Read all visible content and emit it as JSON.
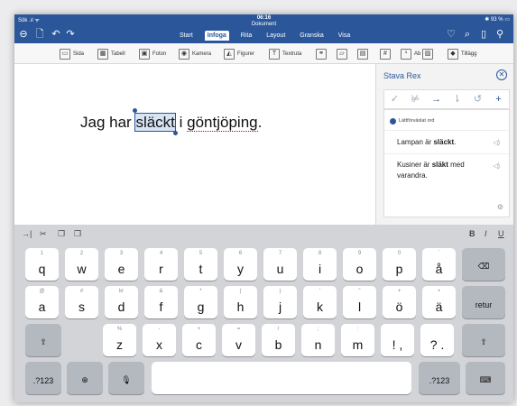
{
  "status": {
    "left": "Sök  .ıl ᯤ",
    "time": "06:16",
    "document": "Dokument",
    "battery": "93 %"
  },
  "ribbon_tabs": [
    "Start",
    "Infoga",
    "Rita",
    "Layout",
    "Granska",
    "Visa"
  ],
  "active_tab": "Infoga",
  "ribbon_items": [
    {
      "label": "Sida",
      "icon": "page-icon"
    },
    {
      "label": "Tabell",
      "icon": "table-icon"
    },
    {
      "label": "Foton",
      "icon": "photo-icon"
    },
    {
      "label": "Kamera",
      "icon": "camera-icon"
    },
    {
      "label": "Figurer",
      "icon": "shapes-icon"
    },
    {
      "label": "Textruta",
      "icon": "textbox-icon"
    },
    {
      "label": "",
      "icon": "link-icon"
    },
    {
      "label": "",
      "icon": "comment-icon"
    },
    {
      "label": "",
      "icon": "header-icon"
    },
    {
      "label": "",
      "icon": "number-icon"
    },
    {
      "label": "Ab",
      "icon": "footnote-icon"
    },
    {
      "label": "",
      "icon": "image-icon"
    },
    {
      "label": "Tillägg",
      "icon": "addin-icon"
    }
  ],
  "document": {
    "before": "Jag har ",
    "selected": "släckt",
    "middle": " i ",
    "misspelled": "göntjöping",
    "after": "."
  },
  "pane": {
    "title": "Stava Rex",
    "easy_label": "Lättförväxlat ord",
    "suggestions": [
      {
        "pre": "Lampan är ",
        "bold": "släckt",
        "post": "."
      },
      {
        "pre": "Kusiner är ",
        "bold": "släkt",
        "post": " med varandra."
      }
    ]
  },
  "keyboard": {
    "toolbar": {
      "bold": "B",
      "italic": "I",
      "underline": "U"
    },
    "row1": [
      {
        "main": "q",
        "alt": "1"
      },
      {
        "main": "w",
        "alt": "2"
      },
      {
        "main": "e",
        "alt": "3"
      },
      {
        "main": "r",
        "alt": "4"
      },
      {
        "main": "t",
        "alt": "5"
      },
      {
        "main": "y",
        "alt": "6"
      },
      {
        "main": "u",
        "alt": "7"
      },
      {
        "main": "i",
        "alt": "8"
      },
      {
        "main": "o",
        "alt": "9"
      },
      {
        "main": "p",
        "alt": "0"
      },
      {
        "main": "å",
        "alt": "´"
      }
    ],
    "row2": [
      {
        "main": "a",
        "alt": "@"
      },
      {
        "main": "s",
        "alt": "#"
      },
      {
        "main": "d",
        "alt": "kr"
      },
      {
        "main": "f",
        "alt": "&"
      },
      {
        "main": "g",
        "alt": "*"
      },
      {
        "main": "h",
        "alt": "("
      },
      {
        "main": "j",
        "alt": ")"
      },
      {
        "main": "k",
        "alt": "'"
      },
      {
        "main": "l",
        "alt": "\""
      },
      {
        "main": "ö",
        "alt": "+"
      },
      {
        "main": "ä",
        "alt": "•"
      }
    ],
    "row3": [
      {
        "main": "z",
        "alt": "%"
      },
      {
        "main": "x",
        "alt": "-"
      },
      {
        "main": "c",
        "alt": "+"
      },
      {
        "main": "v",
        "alt": "="
      },
      {
        "main": "b",
        "alt": "/"
      },
      {
        "main": "n",
        "alt": ";"
      },
      {
        "main": "m",
        "alt": ":"
      },
      {
        "main": "!\n,",
        "alt": ""
      },
      {
        "main": "?\n.",
        "alt": ""
      }
    ],
    "return_label": "retur",
    "numbers_label": ".?123"
  }
}
